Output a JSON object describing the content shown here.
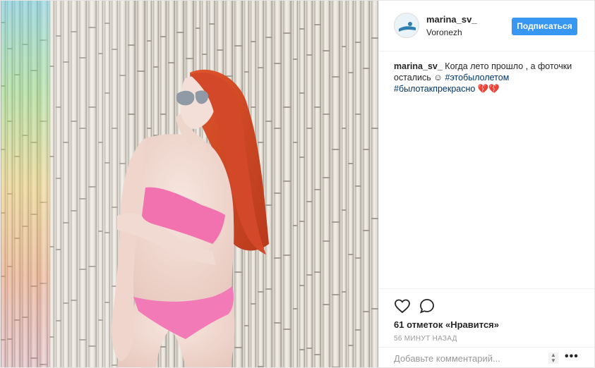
{
  "post": {
    "photo_alt": "",
    "header": {
      "username": "marina_sv_",
      "location": "Voronezh",
      "follow_label": "Подписаться"
    },
    "caption": {
      "username": "marina_sv_",
      "text": " Когда лето прошло , а фоточки остались ☺ ",
      "hashtag_1": "#этобылолетом",
      "hashtag_2": "#былотакпрекрасно",
      "emoji": " 💔💔"
    },
    "actions": {
      "like_icon": "heart-icon",
      "comment_icon": "comment-icon"
    },
    "likes_text": "61 отметок «Нравится»",
    "time_text": "56 МИНУТ НАЗАД",
    "comment": {
      "placeholder": "Добавьте комментарий...",
      "more_label": "•••"
    }
  }
}
